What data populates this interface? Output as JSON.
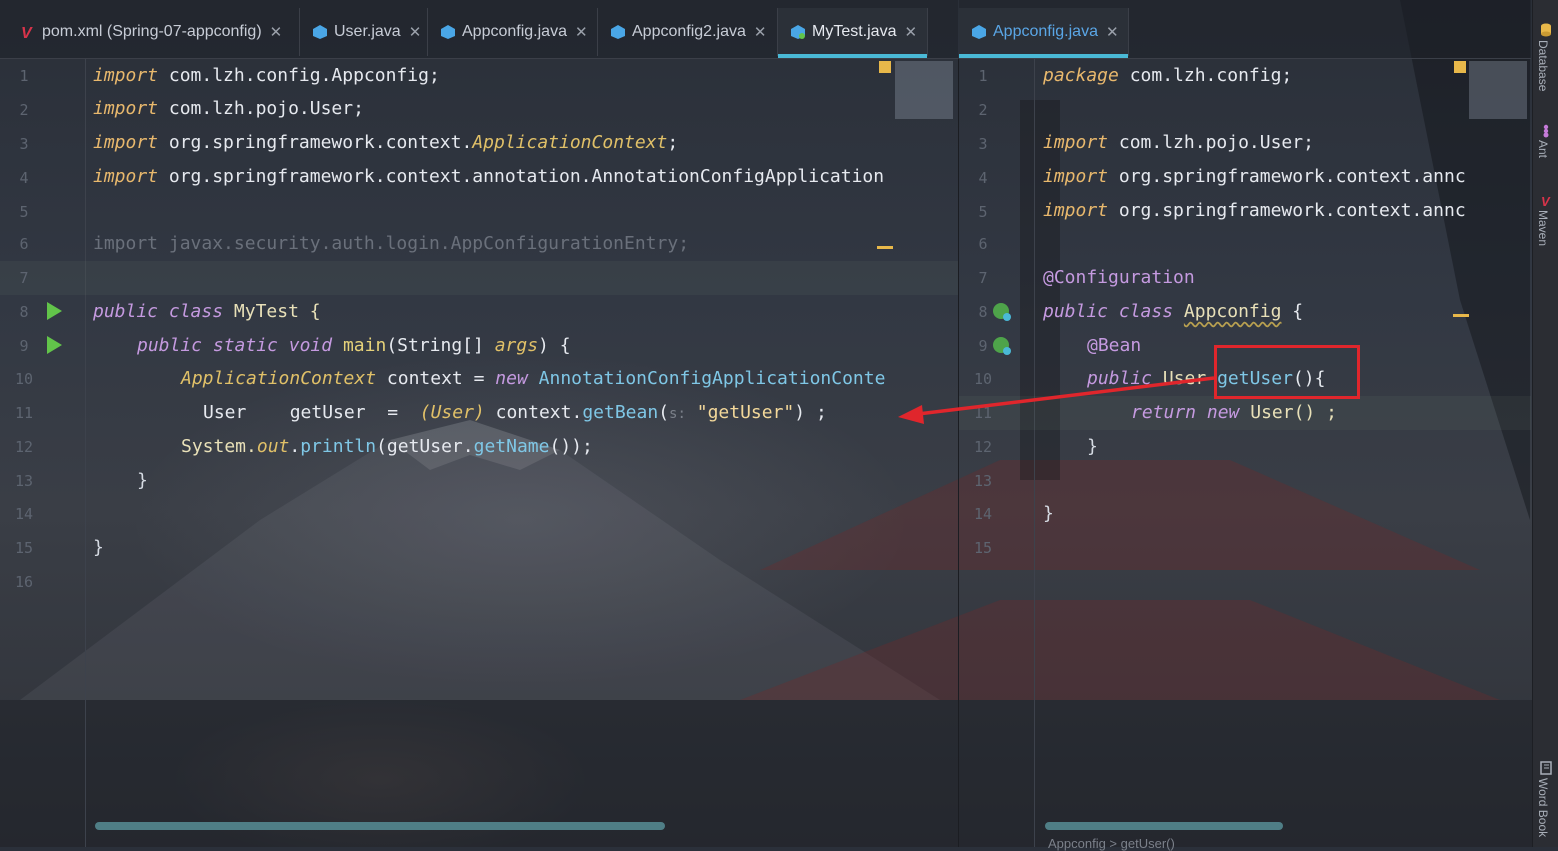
{
  "left_tabs": [
    {
      "label": "pom.xml (Spring-07-appconfig)",
      "icon": "maven-icon"
    },
    {
      "label": "User.java",
      "icon": "class-icon"
    },
    {
      "label": "Appconfig.java",
      "icon": "class-icon"
    },
    {
      "label": "Appconfig2.java",
      "icon": "class-icon"
    },
    {
      "label": "MyTest.java",
      "icon": "class-icon",
      "active": true
    }
  ],
  "right_tabs": [
    {
      "label": "Appconfig.java",
      "icon": "class-icon",
      "active": true
    }
  ],
  "left_editor": {
    "line_numbers": [
      "1",
      "2",
      "3",
      "4",
      "5",
      "6",
      "7",
      "8",
      "9",
      "10",
      "11",
      "12",
      "13",
      "14",
      "15",
      "16"
    ],
    "l1": {
      "kw": "import",
      "rest": " com.lzh.config.Appconfig;"
    },
    "l2": {
      "kw": "import",
      "rest": " com.lzh.pojo.User;"
    },
    "l3": {
      "kw": "import",
      "pre": " org.springframework.context.",
      "iface": "ApplicationContext",
      "post": ";"
    },
    "l4": {
      "kw": "import",
      "rest": " org.springframework.context.annotation.AnnotationConfigApplication"
    },
    "l6": "import javax.security.auth.login.AppConfigurationEntry;",
    "l8": {
      "kw1": "public",
      "kw2": "class",
      "rest": " MyTest {"
    },
    "l9": {
      "kw1": "public",
      "kw2": "static",
      "kw3": "void",
      "fn": "main",
      "p1": "(String[] ",
      "arg": "args",
      "p2": ") {"
    },
    "l10": {
      "iface": "ApplicationContext",
      "mid": " context = ",
      "kw": "new",
      "cls": " AnnotationConfigApplicationConte"
    },
    "l11": {
      "a": "User    getUser  =  ",
      "cast": "(User)",
      "b": " context.",
      "m": "getBean",
      "c": "(",
      "hint": "s:",
      "str": "\"getUser\"",
      "d": ") ;"
    },
    "l12": {
      "a": "System.",
      "out": "out",
      "b": ".",
      "m1": "println",
      "c": "(getUser.",
      "m2": "getName",
      "d": "());"
    },
    "l13": "}",
    "l15": "}"
  },
  "right_editor": {
    "line_numbers": [
      "1",
      "2",
      "3",
      "4",
      "5",
      "6",
      "7",
      "8",
      "9",
      "10",
      "11",
      "12",
      "13",
      "14",
      "15"
    ],
    "l1": {
      "kw": "package",
      "rest": " com.lzh.config;"
    },
    "l3": {
      "kw": "import",
      "rest": " com.lzh.pojo.User;"
    },
    "l4": {
      "kw": "import",
      "rest": " org.springframework.context.annc"
    },
    "l5": {
      "kw": "import",
      "rest": " org.springframework.context.annc"
    },
    "l7": "@Configuration",
    "l8": {
      "kw1": "public",
      "kw2": "class",
      "name": "Appconfig",
      "rest": " {"
    },
    "l9": "@Bean",
    "l10": {
      "kw": "public",
      "type": " User ",
      "fn": "getUser",
      "rest": "(){"
    },
    "l11": {
      "kw1": "return",
      "kw2": "new",
      "rest": " User() ;"
    },
    "l12": "}",
    "l14": "}"
  },
  "toolstrip": {
    "items": [
      {
        "label": "Database",
        "icon": "database-icon"
      },
      {
        "label": "Ant",
        "icon": "ant-icon"
      },
      {
        "label": "Maven",
        "icon": "maven-icon"
      },
      {
        "label": "Word Book",
        "icon": "book-icon"
      }
    ]
  },
  "breadcrumb": "Appconfig  >  getUser()",
  "colors": {
    "accent": "#4ab9d6",
    "keyword": "#e8b86d",
    "annotation_box": "#e0262c"
  }
}
